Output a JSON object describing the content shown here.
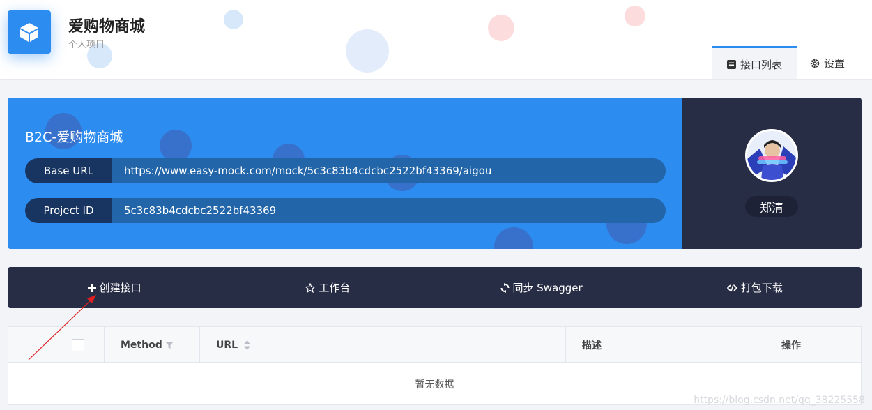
{
  "header": {
    "title": "爱购物商城",
    "subtitle": "个人项目",
    "tabs": [
      {
        "label": "接口列表",
        "icon": "list-icon",
        "active": true
      },
      {
        "label": "设置",
        "icon": "gear-icon",
        "active": false
      }
    ]
  },
  "banner": {
    "title": "B2C-爱购物商城",
    "rows": [
      {
        "label": "Base URL",
        "value": "https://www.easy-mock.com/mock/5c3c83b4cdcbc2522bf43369/aigou"
      },
      {
        "label": "Project ID",
        "value": "5c3c83b4cdcbc2522bf43369"
      }
    ]
  },
  "user": {
    "name": "郑清"
  },
  "toolbar": {
    "items": [
      {
        "label": "创建接口",
        "icon": "plus-icon"
      },
      {
        "label": "工作台",
        "icon": "star-icon"
      },
      {
        "label": "同步 Swagger",
        "icon": "sync-icon"
      },
      {
        "label": "打包下载",
        "icon": "code-icon"
      }
    ]
  },
  "table": {
    "columns": {
      "method": "Method",
      "url": "URL",
      "desc": "描述",
      "actions": "操作"
    },
    "empty_text": "暂无数据"
  },
  "watermark": "https://blog.csdn.net/qq_38225558",
  "colors": {
    "primary": "#2d8cf0",
    "dark": "#272d45",
    "annotation": "#e02020"
  }
}
